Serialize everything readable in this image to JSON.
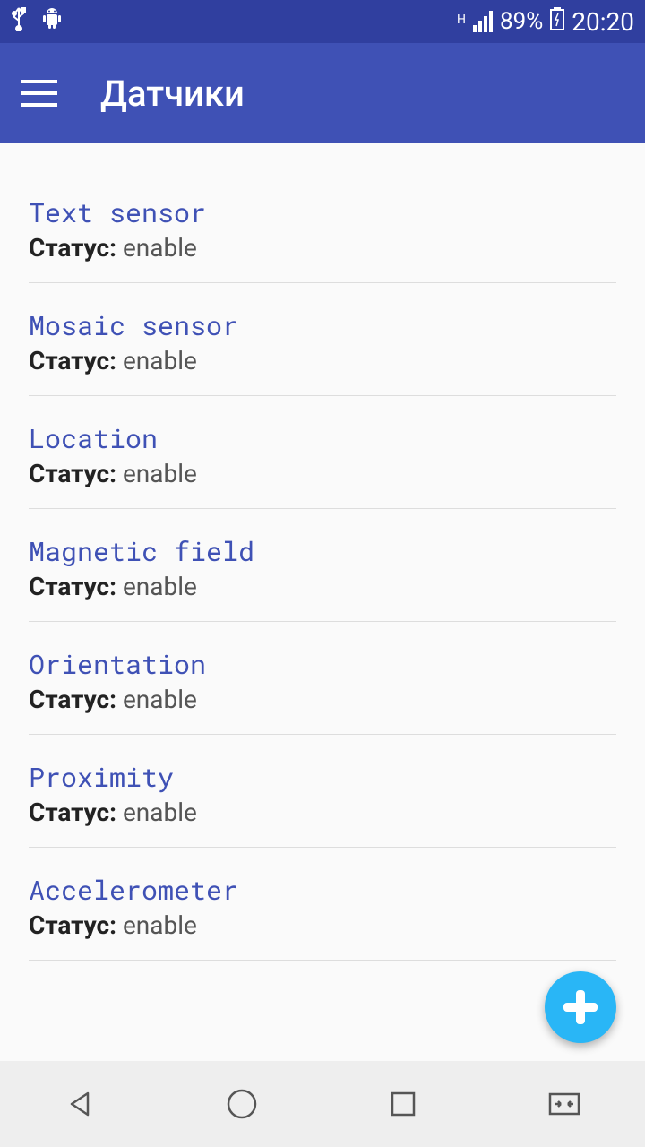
{
  "status": {
    "network_indicator": "H",
    "battery_pct": "89%",
    "time": "20:20"
  },
  "header": {
    "title": "Датчики"
  },
  "status_label": "Статус:",
  "sensors": [
    {
      "name": "Text sensor",
      "status": "enable"
    },
    {
      "name": "Mosaic sensor",
      "status": "enable"
    },
    {
      "name": "Location",
      "status": "enable"
    },
    {
      "name": "Magnetic field",
      "status": "enable"
    },
    {
      "name": "Orientation",
      "status": "enable"
    },
    {
      "name": "Proximity",
      "status": "enable"
    },
    {
      "name": "Accelerometer",
      "status": "enable"
    }
  ]
}
